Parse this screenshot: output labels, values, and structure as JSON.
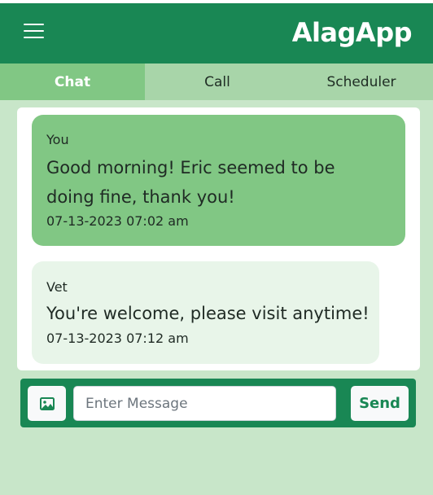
{
  "app": {
    "title": "AlagApp"
  },
  "icons": {
    "menu": "hamburger-menu-icon",
    "attach": "image-icon"
  },
  "colors": {
    "brand": "#198754",
    "tab_bar": "#a8d5a9",
    "tab_active": "#81c784",
    "background": "#c8e6c9",
    "bubble_me": "#81c784",
    "bubble_them": "#e8f5e9"
  },
  "tabs": [
    {
      "label": "Chat",
      "active": true
    },
    {
      "label": "Call",
      "active": false
    },
    {
      "label": "Scheduler",
      "active": false
    }
  ],
  "messages": [
    {
      "sender": "You",
      "lines": [
        "Good morning! Eric seemed to be",
        "doing fine, thank you!"
      ],
      "timestamp": "07-13-2023 07:02 am"
    },
    {
      "sender": "Vet",
      "lines": [
        "You're welcome, please visit anytime!"
      ],
      "timestamp": "07-13-2023 07:12 am"
    }
  ],
  "composer": {
    "placeholder": "Enter Message",
    "value": "",
    "send_label": "Send"
  }
}
